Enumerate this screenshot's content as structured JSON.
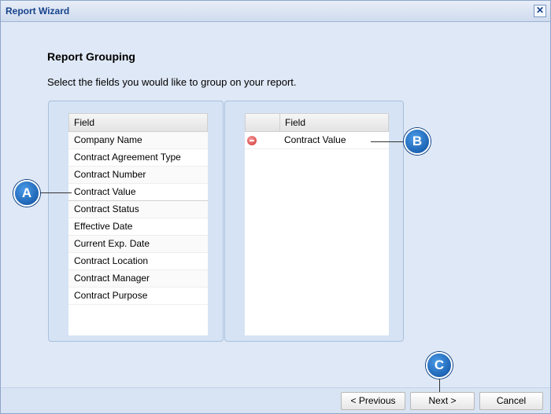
{
  "window": {
    "title": "Report Wizard",
    "close_glyph": "✕"
  },
  "heading": "Report Grouping",
  "instruction": "Select the fields you would like to group on your report.",
  "available_fields": {
    "header": "Field",
    "items": [
      "Company Name",
      "Contract Agreement Type",
      "Contract Number",
      "Contract Value",
      "Contract Status",
      "Effective Date",
      "Current Exp. Date",
      "Contract Location",
      "Contract Manager",
      "Contract Purpose"
    ],
    "selected": "Contract Value"
  },
  "grouped_fields": {
    "header": "Field",
    "items": [
      {
        "label": "Contract Value",
        "icon": "remove-icon"
      }
    ]
  },
  "buttons": {
    "previous": "< Previous",
    "next": "Next >",
    "cancel": "Cancel"
  },
  "callouts": {
    "a": "A",
    "b": "B",
    "c": "C"
  },
  "colors": {
    "title": "#15428b",
    "callout": "#1565c0",
    "remove": "#d0322f"
  }
}
